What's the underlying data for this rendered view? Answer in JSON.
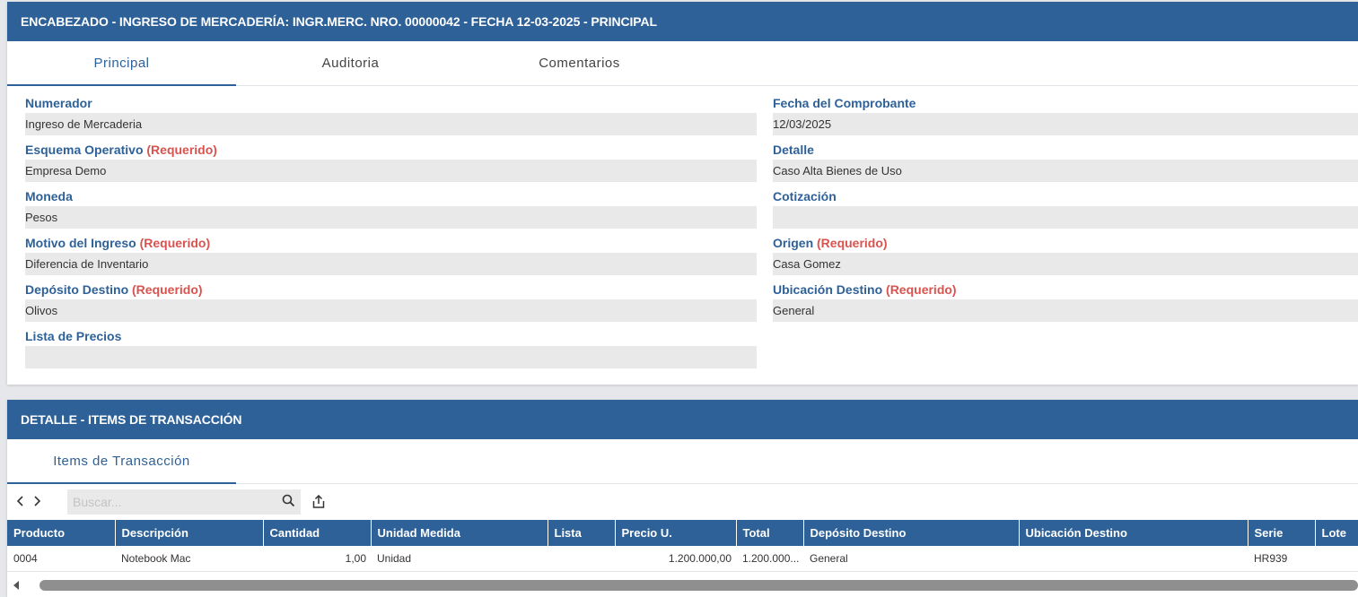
{
  "header_panel": {
    "title": "ENCABEZADO - INGRESO DE MERCADERÍA: INGR.MERC. NRO. 00000042 - FECHA 12-03-2025 - PRINCIPAL",
    "tabs": [
      {
        "label": "Principal",
        "active": true
      },
      {
        "label": "Auditoria",
        "active": false
      },
      {
        "label": "Comentarios",
        "active": false
      }
    ],
    "required_text": "(Requerido)",
    "fields": {
      "numerador": {
        "label": "Numerador",
        "value": "Ingreso de Mercaderia"
      },
      "esquema": {
        "label": "Esquema Operativo",
        "value": "Empresa Demo"
      },
      "moneda": {
        "label": "Moneda",
        "value": "Pesos"
      },
      "motivo": {
        "label": "Motivo del Ingreso",
        "value": "Diferencia de Inventario"
      },
      "deposito": {
        "label": "Depósito Destino",
        "value": "Olivos"
      },
      "lista": {
        "label": "Lista de Precios",
        "value": ""
      },
      "fecha": {
        "label": "Fecha del Comprobante",
        "value": "12/03/2025"
      },
      "detalle": {
        "label": "Detalle",
        "value": "Caso Alta Bienes de Uso"
      },
      "cotizacion": {
        "label": "Cotización",
        "value": ""
      },
      "origen": {
        "label": "Origen",
        "value": "Casa Gomez"
      },
      "ubicacion": {
        "label": "Ubicación Destino",
        "value": "General"
      }
    }
  },
  "detail_panel": {
    "title": "DETALLE - ITEMS DE TRANSACCIÓN",
    "tabs": [
      {
        "label": "Items de Transacción",
        "active": true
      }
    ],
    "toolbar": {
      "prev_icon": "‹",
      "next_icon": "›",
      "search_placeholder": "Buscar..."
    },
    "table": {
      "columns": [
        "Producto",
        "Descripción",
        "Cantidad",
        "Unidad Medida",
        "Lista",
        "Precio U.",
        "Total",
        "Depósito Destino",
        "Ubicación Destino",
        "Serie",
        "Lote"
      ],
      "rows": [
        {
          "producto": "0004",
          "descripcion": "Notebook Mac",
          "cantidad": "1,00",
          "unidad": "Unidad",
          "lista": "",
          "precio": "1.200.000,00",
          "total": "1.200.000...",
          "deposito": "General",
          "ubicacion": "",
          "serie": "HR939",
          "lote": ""
        }
      ]
    }
  },
  "colors": {
    "header_blue": "#2e6198",
    "required_red": "#d9534f",
    "field_bg": "#e9e9e9"
  }
}
